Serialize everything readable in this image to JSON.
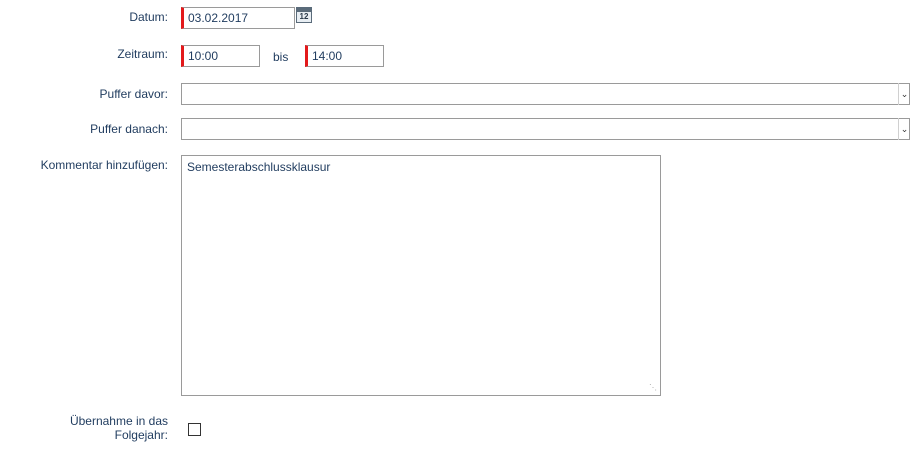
{
  "labels": {
    "datum": "Datum:",
    "zeitraum": "Zeitraum:",
    "bis": "bis",
    "puffer_davor": "Puffer davor:",
    "puffer_danach": "Puffer danach:",
    "kommentar": "Kommentar hinzufügen:",
    "uebernahme_line1": "Übernahme in das",
    "uebernahme_line2": "Folgejahr:"
  },
  "fields": {
    "datum": "03.02.2017",
    "zeit_von": "10:00",
    "zeit_bis": "14:00",
    "puffer_davor": "",
    "puffer_danach": "",
    "kommentar": "Semesterabschlussklausur",
    "uebernahme_checked": false
  },
  "icons": {
    "calendar_day": "12",
    "dropdown": "chevron-down-icon",
    "resize": "resize-grip-icon"
  },
  "colors": {
    "label_text": "#1f3b5e",
    "required_marker": "#e3191b",
    "border": "#9a9a9a"
  }
}
